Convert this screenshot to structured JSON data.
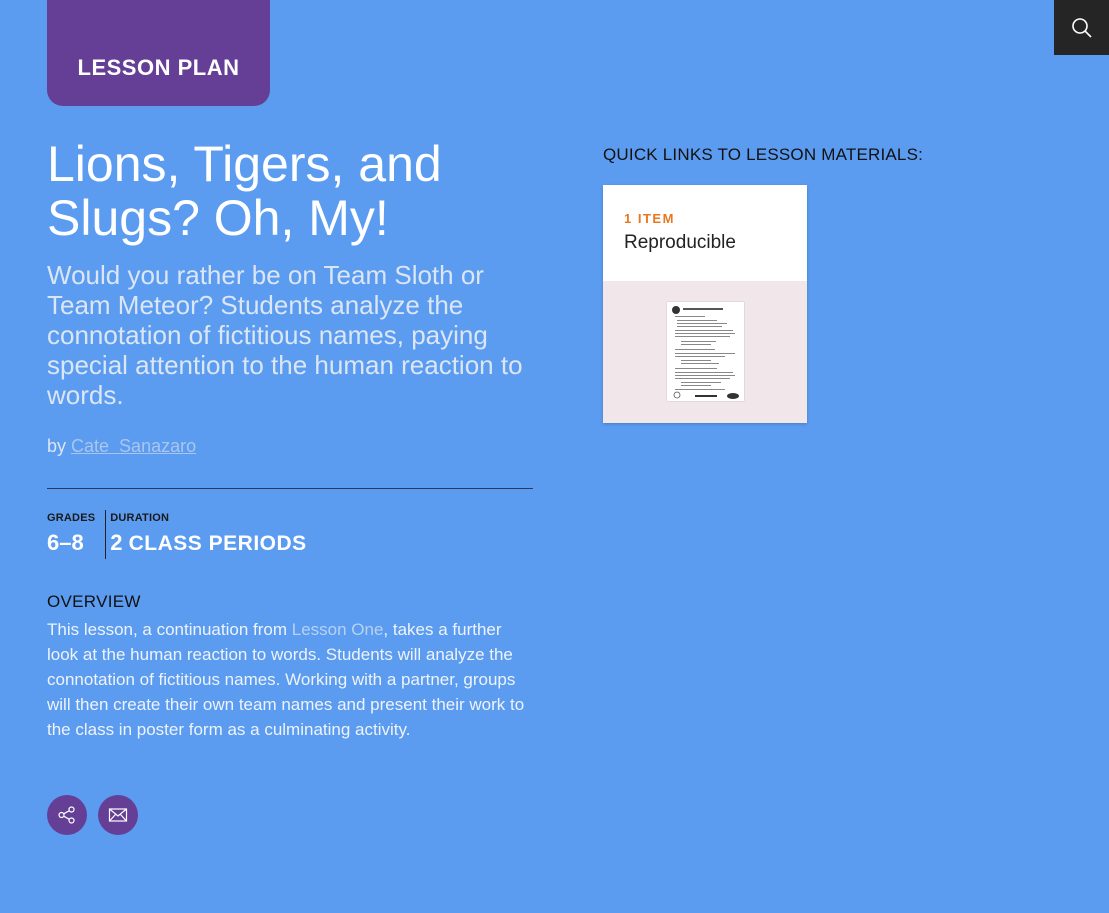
{
  "badge": {
    "label": "LESSON PLAN"
  },
  "search": {
    "icon": "search-icon"
  },
  "lesson": {
    "title": "Lions, Tigers, and Slugs? Oh, My!",
    "subtitle": "Would you rather be on Team Sloth or Team Meteor? Students analyze the connotation of fictitious names, paying special attention to the human reaction to words.",
    "by_label": "by",
    "author": "Cate  Sanazaro"
  },
  "meta": {
    "grades_label": "GRADES",
    "grades_value": "6–8",
    "duration_label": "DURATION",
    "duration_number": "2",
    "duration_unit": "CLASS PERIODS"
  },
  "overview": {
    "heading": "OVERVIEW",
    "text_before": "This lesson, a continuation from ",
    "link": "Lesson One",
    "text_after": ", takes a further look at the human reaction to words. Students will analyze the connotation of fictitious names. Working with a partner, groups will then create their own team names and present their work to the class in poster form as a culminating activity."
  },
  "share": {
    "share_icon": "share-icon",
    "email_icon": "email-icon"
  },
  "quick_links": {
    "heading": "QUICK LINKS TO LESSON MATERIALS:",
    "cards": [
      {
        "count": "1 ITEM",
        "type": "Reproducible"
      }
    ]
  },
  "colors": {
    "background": "#5b9cf0",
    "badge": "#653f95",
    "accent": "#e8781e"
  }
}
